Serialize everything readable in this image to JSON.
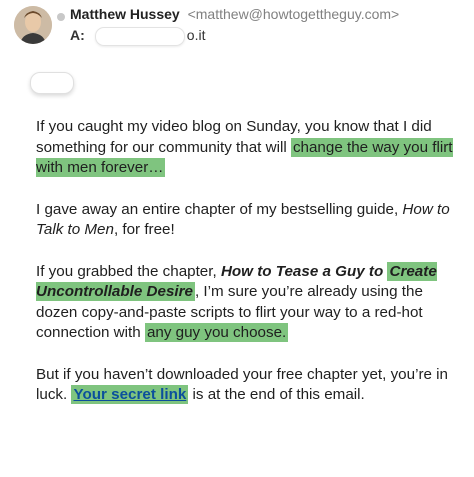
{
  "header": {
    "sender_name": "Matthew Hussey",
    "sender_email": "<matthew@howtogettheguy.com>",
    "to_label": "A:",
    "to_suffix": "o.it"
  },
  "body": {
    "p1_a": "If you caught my video blog on Sunday, you know that I did something for our community that will",
    "p1_hl": "change the way you flirt with men forever…",
    "p2_a": "I gave away an entire chapter of my bestselling guide,",
    "p2_it": "How to Talk to Men",
    "p2_b": ", for free!",
    "p3_a": "If you grabbed the chapter,",
    "p3_bi1": "How to Tease a Guy to",
    "p3_bi_hl": "Create Uncontrollable Desire",
    "p3_b": ", I’m sure you’re already using the dozen copy-and-paste scripts to flirt your way to a red-hot connection with",
    "p3_hl": "any guy you choose.",
    "p4_a": "But if you haven’t downloaded your free chapter yet, you’re in luck.",
    "p4_link": "Your secret link",
    "p4_b": "is at the end of this email."
  },
  "colors": {
    "highlight": "#7fc47f",
    "link": "#0b4f9c"
  },
  "icons": {
    "avatar": "avatar-photo",
    "status": "status-dot"
  }
}
